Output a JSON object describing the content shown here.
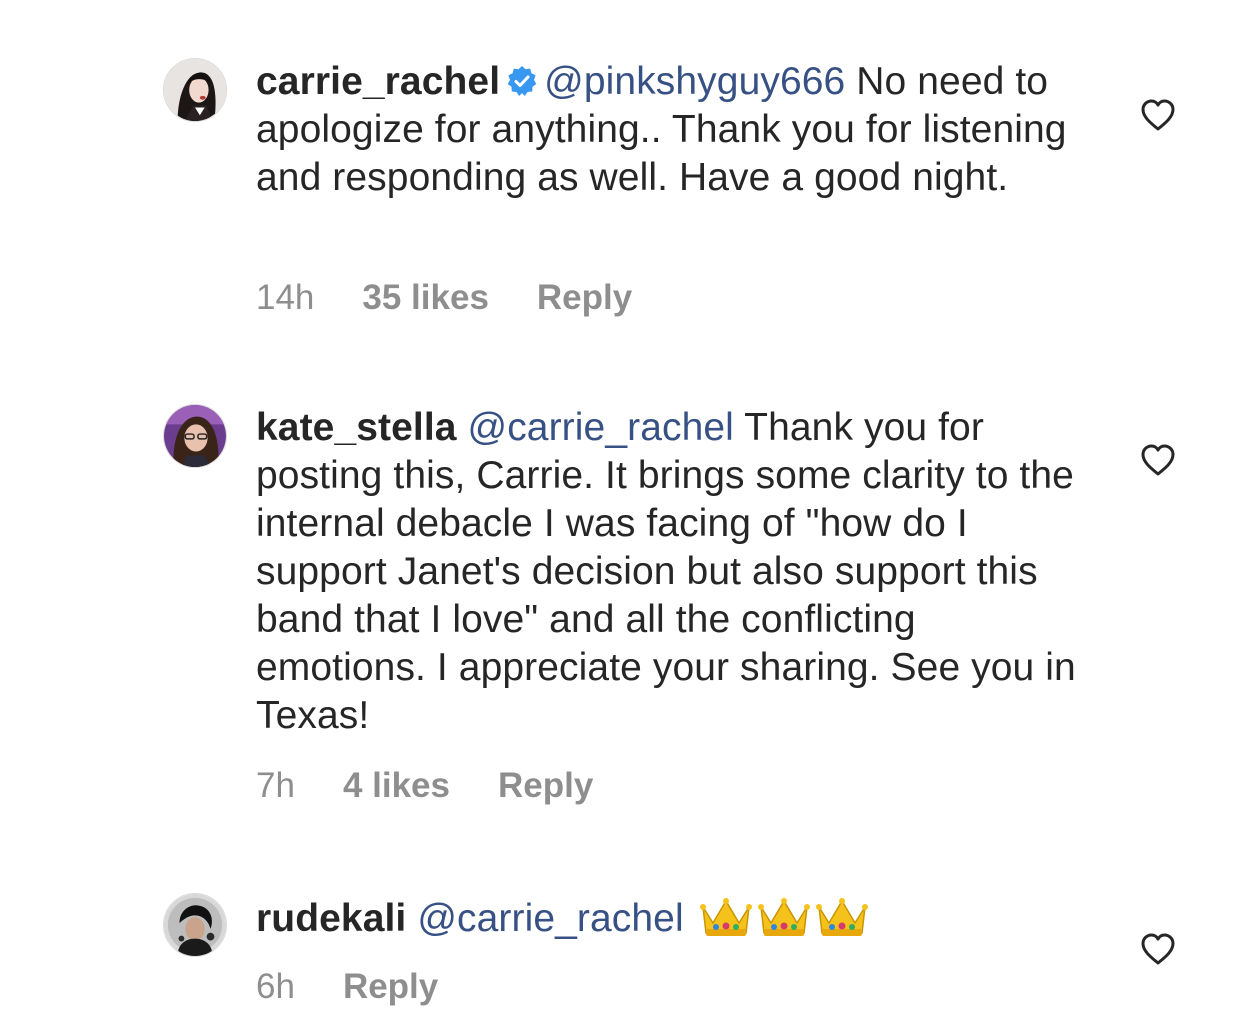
{
  "comments": [
    {
      "username": "carrie_rachel",
      "verified": true,
      "mention": "@pinkshyguy666",
      "text": " No need to apologize for anything.. Thank you for listening and responding as well. Have a good night.",
      "time": "14h",
      "likes": "35 likes",
      "reply": "Reply",
      "avatar_icon": "avatar-carrie",
      "like_icon": "heart-outline-icon"
    },
    {
      "username": "kate_stella",
      "verified": false,
      "mention": "@carrie_rachel",
      "text": " Thank you for posting this, Carrie. It brings some clarity to the internal debacle I was facing of \"how do I support Janet's decision but also support this band that I love\" and all the conflicting emotions. I appreciate your sharing. See you in Texas!",
      "time": "7h",
      "likes": "4 likes",
      "reply": "Reply",
      "avatar_icon": "avatar-kate",
      "like_icon": "heart-outline-icon"
    },
    {
      "username": "rudekali",
      "verified": false,
      "mention": "@carrie_rachel",
      "text": "",
      "emoji": [
        "crown-emoji",
        "crown-emoji",
        "crown-emoji"
      ],
      "time": "6h",
      "reply": "Reply",
      "avatar_icon": "avatar-rudekali",
      "like_icon": "heart-outline-icon"
    }
  ],
  "colors": {
    "text": "#262626",
    "mention": "#385185",
    "meta": "#8e8e8e",
    "verified": "#3897f0"
  }
}
